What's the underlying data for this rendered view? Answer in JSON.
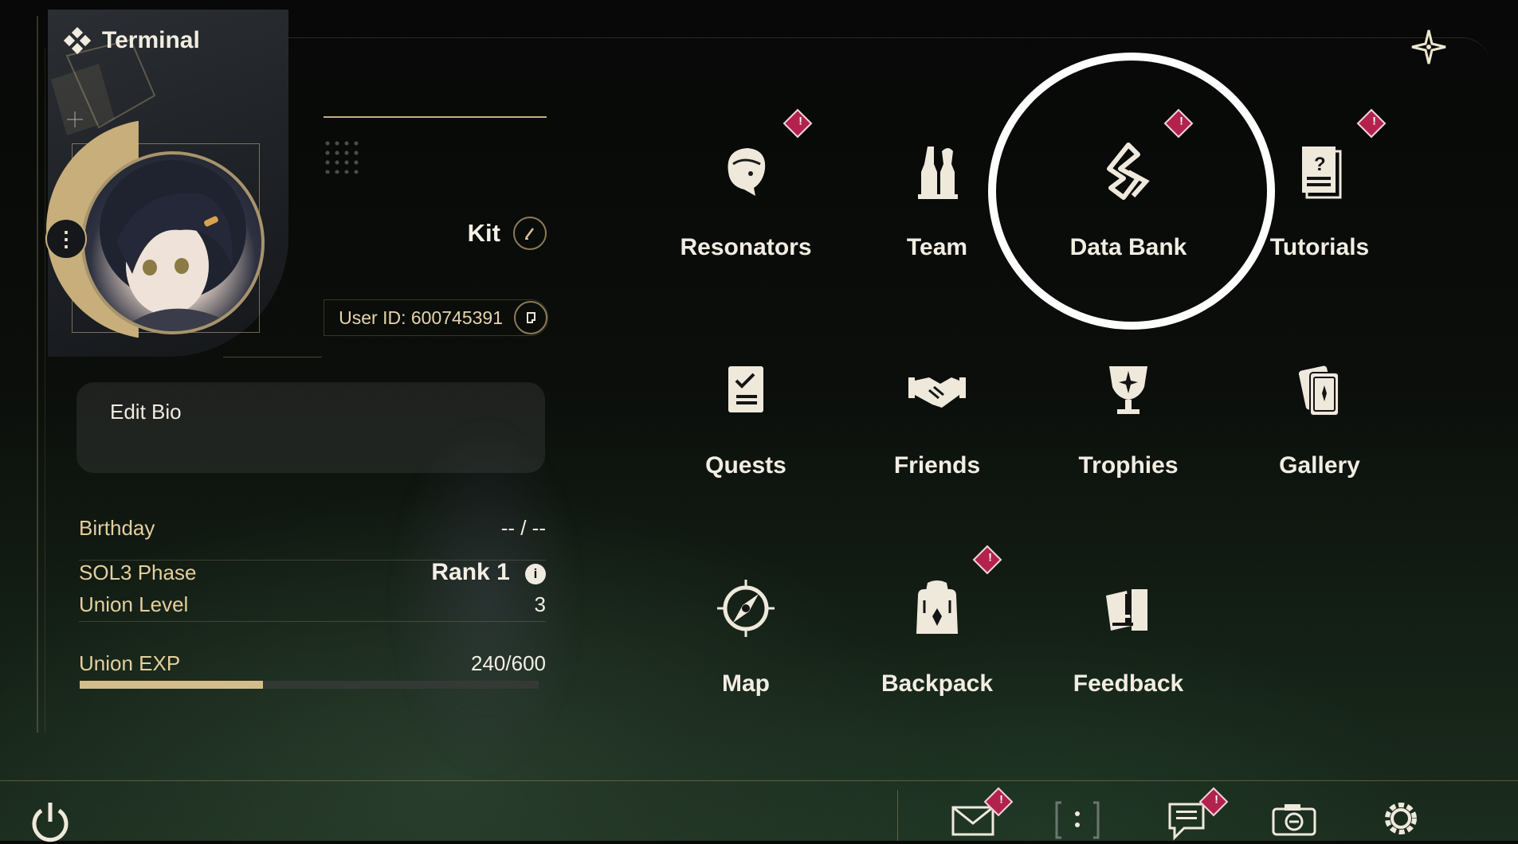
{
  "app": {
    "title": "Terminal"
  },
  "profile": {
    "name": "Kit",
    "user_id": "User ID: 600745391",
    "bio_placeholder": "Edit Bio"
  },
  "stats": {
    "birthday_label": "Birthday",
    "birthday_value": "-- / --",
    "sol3_label": "SOL3 Phase",
    "sol3_value": "Rank 1",
    "union_level_label": "Union Level",
    "union_level_value": "3",
    "union_exp_label": "Union EXP",
    "union_exp_value": "240/600",
    "union_exp_fraction": 0.4
  },
  "menu": {
    "items": [
      {
        "label": "Resonators",
        "icon": "resonator-head-icon",
        "alert": true
      },
      {
        "label": "Team",
        "icon": "team-chess-icon",
        "alert": false
      },
      {
        "label": "Data Bank",
        "icon": "data-bank-icon",
        "alert": true,
        "highlighted": true
      },
      {
        "label": "Tutorials",
        "icon": "tutorial-book-icon",
        "alert": true
      },
      {
        "label": "Quests",
        "icon": "quest-checklist-icon",
        "alert": false
      },
      {
        "label": "Friends",
        "icon": "handshake-icon",
        "alert": false
      },
      {
        "label": "Trophies",
        "icon": "trophy-icon",
        "alert": false
      },
      {
        "label": "Gallery",
        "icon": "gallery-cards-icon",
        "alert": false
      },
      {
        "label": "Map",
        "icon": "compass-icon",
        "alert": false
      },
      {
        "label": "Backpack",
        "icon": "backpack-icon",
        "alert": true
      },
      {
        "label": "Feedback",
        "icon": "feedback-icon",
        "alert": false
      }
    ]
  },
  "bottom_bar": {
    "icons": [
      "power-icon",
      "mail-icon",
      "bracket-icon",
      "notice-icon",
      "camera-icon",
      "settings-gear-icon"
    ],
    "alerts": {
      "mail": true,
      "notice": true
    }
  },
  "colors": {
    "accent_gold": "#c7ae7b",
    "alert_red": "#b3224d",
    "highlight": "#ffffff"
  }
}
